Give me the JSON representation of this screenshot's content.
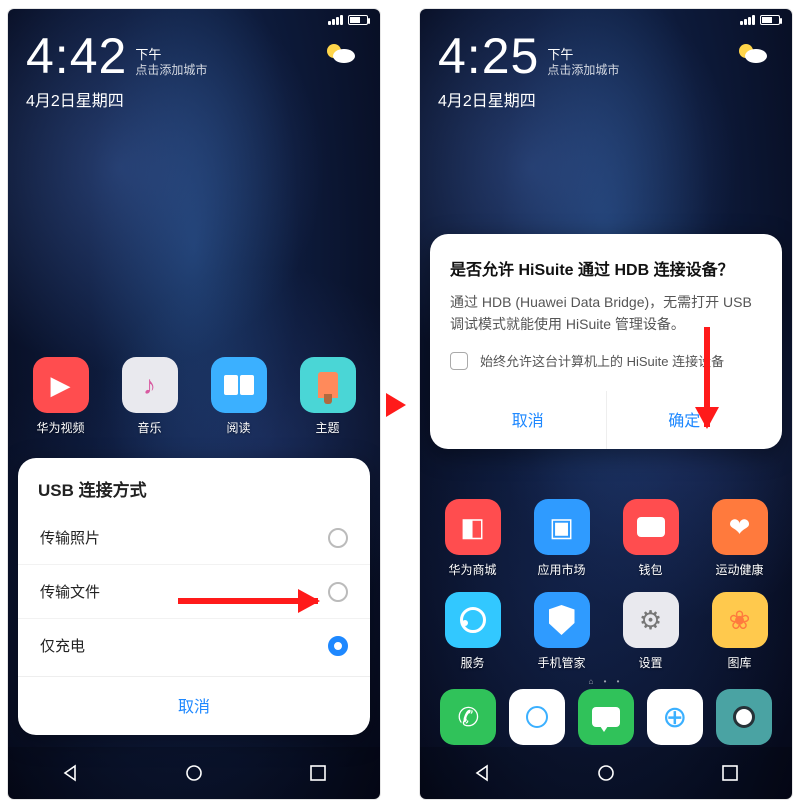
{
  "left": {
    "time": "4:42",
    "ampm": "下午",
    "city_hint": "点击添加城市",
    "date": "4月2日星期四",
    "apps": [
      {
        "label": "华为视频",
        "bg": "#ff4d4f",
        "glyph": "▶"
      },
      {
        "label": "音乐",
        "bg": "#e9e9ee",
        "glyph": "♪"
      },
      {
        "label": "阅读",
        "bg": "#3bb0ff",
        "glyph": "▯▯"
      },
      {
        "label": "主题",
        "bg": "#4ad6d6",
        "glyph": "🖌"
      }
    ],
    "sheet": {
      "title": "USB 连接方式",
      "options": [
        {
          "label": "传输照片",
          "selected": false
        },
        {
          "label": "传输文件",
          "selected": false
        },
        {
          "label": "仅充电",
          "selected": true
        }
      ],
      "cancel": "取消"
    }
  },
  "right": {
    "time": "4:25",
    "ampm": "下午",
    "city_hint": "点击添加城市",
    "date": "4月2日星期四",
    "dialog": {
      "title": "是否允许 HiSuite 通过 HDB 连接设备？",
      "body": "通过 HDB (Huawei Data Bridge)，无需打开 USB 调试模式就能使用 HiSuite 管理设备。",
      "checkbox": "始终允许这台计算机上的 HiSuite 连接设备",
      "cancel": "取消",
      "confirm": "确定"
    },
    "apps_row1": [
      {
        "label": "华为商城",
        "bg": "#ff4d4f",
        "glyph": "◧"
      },
      {
        "label": "应用市场",
        "bg": "#2f9bff",
        "glyph": "▣"
      },
      {
        "label": "钱包",
        "bg": "#ff4d4f",
        "glyph": "👛"
      },
      {
        "label": "运动健康",
        "bg": "#ff7a3d",
        "glyph": "❤"
      }
    ],
    "apps_row2": [
      {
        "label": "服务",
        "bg": "#32c8ff",
        "glyph": "◉"
      },
      {
        "label": "手机管家",
        "bg": "#2f9bff",
        "glyph": "🛡"
      },
      {
        "label": "设置",
        "bg": "#e9e9ee",
        "glyph": "⚙"
      },
      {
        "label": "图库",
        "bg": "#ffc94d",
        "glyph": "❀"
      }
    ],
    "dock": [
      {
        "bg": "#30c25a",
        "glyph": "✆"
      },
      {
        "bg": "#ffffff",
        "glyph": "✉"
      },
      {
        "bg": "#30c25a",
        "glyph": "✉"
      },
      {
        "bg": "#ffffff",
        "glyph": "⌕"
      },
      {
        "bg": "#4aa3a3",
        "glyph": "◉"
      }
    ]
  }
}
